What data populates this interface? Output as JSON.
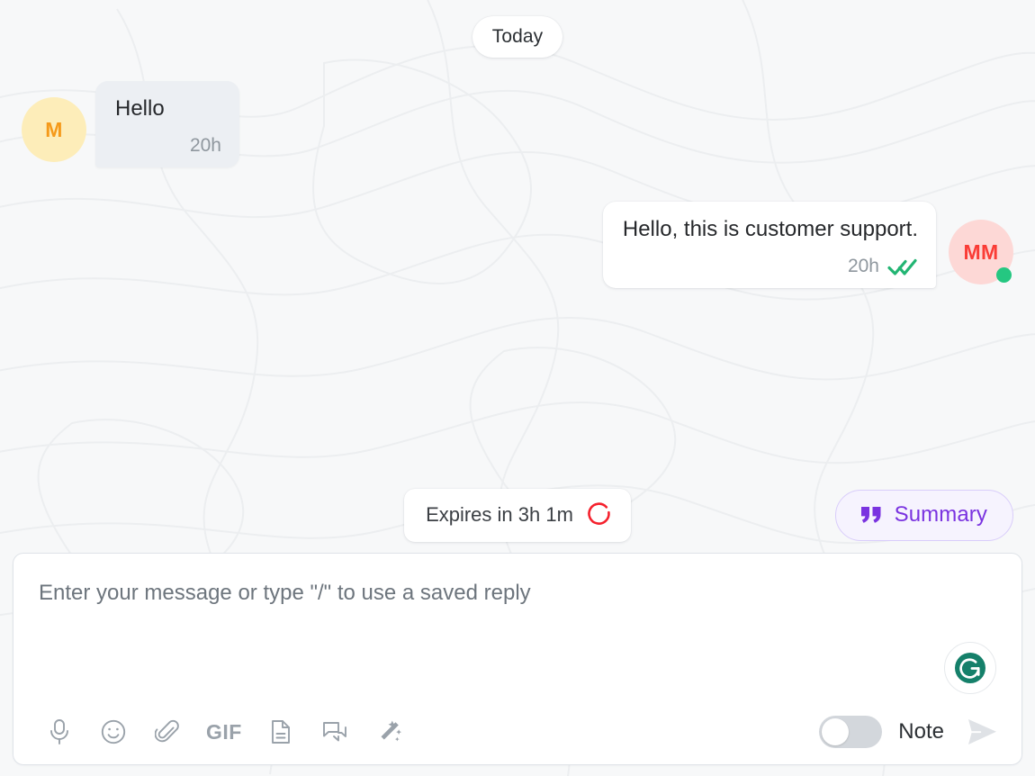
{
  "theme": {
    "background": "#f7f8f9",
    "incoming_bubble_bg": "#eceff3",
    "outgoing_bubble_bg": "#ffffff",
    "accent_purple": "#7a33e0",
    "read_tick_green": "#22b573",
    "expiry_red": "#f5212d",
    "presence_green": "#25c781",
    "grammarly_green": "#15806a"
  },
  "conversation": {
    "date_divider": "Today",
    "messages": [
      {
        "direction": "incoming",
        "avatar_initials": "M",
        "text": "Hello",
        "time": "20h",
        "read_receipt": false,
        "online": false
      },
      {
        "direction": "outgoing",
        "avatar_initials": "MM",
        "text": "Hello, this is customer support.",
        "time": "20h",
        "read_receipt": true,
        "online": true
      }
    ]
  },
  "action_strip": {
    "expires_label": "Expires in 3h 1m",
    "expires_icon": "timer-ring-icon",
    "summary_label": "Summary",
    "summary_icon": "quote-icon"
  },
  "composer": {
    "placeholder": "Enter your message or type \"/\" to use a saved reply",
    "value": "",
    "grammarly_icon": "grammarly-icon",
    "toolbar_items": [
      {
        "name": "microphone-icon",
        "label": ""
      },
      {
        "name": "emoji-icon",
        "label": ""
      },
      {
        "name": "attachment-icon",
        "label": ""
      },
      {
        "name": "gif-icon",
        "label": "GIF"
      },
      {
        "name": "document-icon",
        "label": ""
      },
      {
        "name": "saved-replies-icon",
        "label": ""
      },
      {
        "name": "magic-wand-icon",
        "label": ""
      }
    ],
    "note_toggle": {
      "label": "Note",
      "enabled": false
    },
    "send_icon": "send-icon"
  }
}
